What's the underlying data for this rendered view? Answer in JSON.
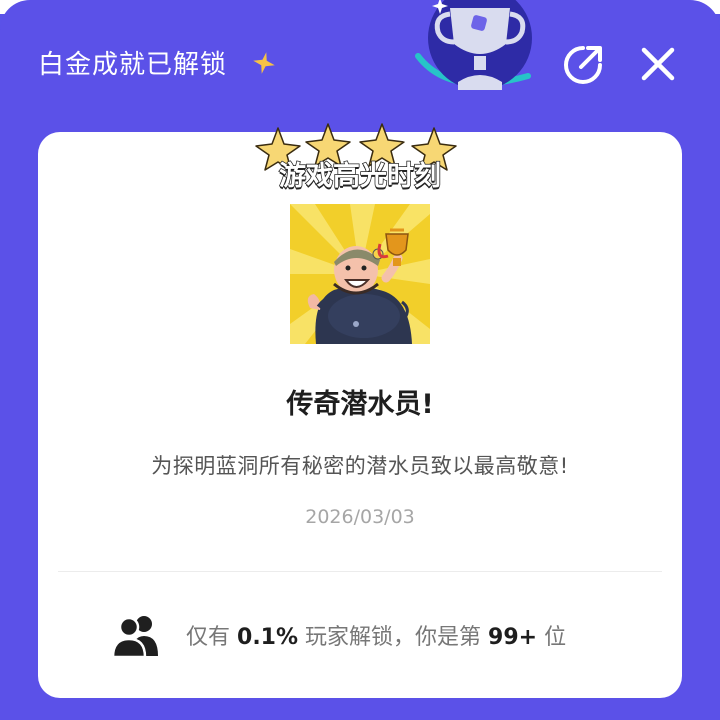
{
  "modal": {
    "title": "白金成就已解锁",
    "share_icon": "share-icon",
    "close_icon": "close-icon",
    "accent_color": "#5b51e8"
  },
  "card": {
    "highlight_label": "游戏高光时刻",
    "achievement_name": "传奇潜水员!",
    "achievement_description": "为探明蓝洞所有秘密的潜水员致以最高敬意!",
    "unlock_date": "2026/03/03",
    "stats": {
      "prefix": "仅有",
      "percent": "0.1%",
      "middle": "玩家解锁，你是第",
      "rank": "99+",
      "suffix": "位"
    }
  }
}
